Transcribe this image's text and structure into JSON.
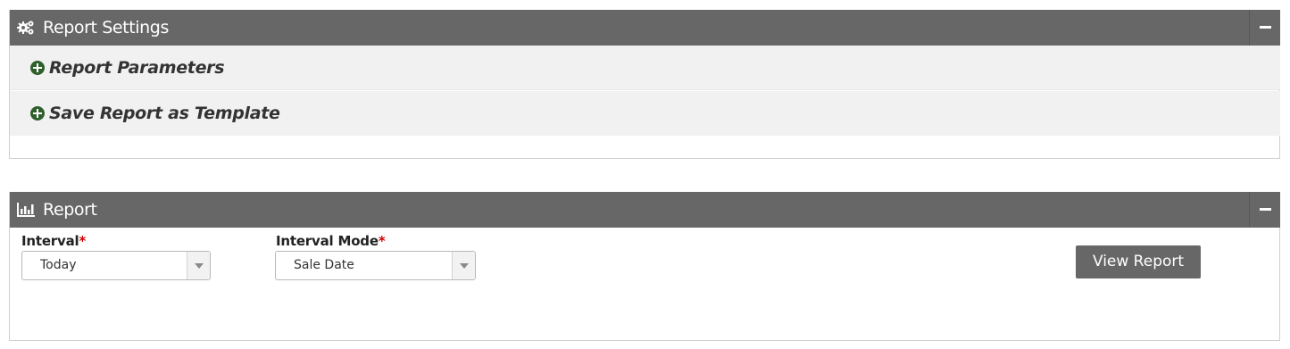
{
  "settings_panel": {
    "title": "Report Settings",
    "icon": "gears-icon",
    "collapse_icon": "minus-icon",
    "sections": [
      {
        "label": "Report Parameters",
        "icon": "plus-circle-icon"
      },
      {
        "label": "Save Report as Template",
        "icon": "plus-circle-icon"
      }
    ]
  },
  "report_panel": {
    "title": "Report",
    "icon": "bar-chart-icon",
    "collapse_icon": "minus-icon",
    "interval": {
      "label": "Interval",
      "required_mark": "*",
      "value": "Today"
    },
    "interval_mode": {
      "label": "Interval Mode",
      "required_mark": "*",
      "value": "Sale Date"
    },
    "view_button": "View Report"
  },
  "colors": {
    "header_bg": "#676767",
    "section_bg": "#f1f1f1",
    "accent_green": "#2f5f2d",
    "required_red": "#d00000"
  }
}
